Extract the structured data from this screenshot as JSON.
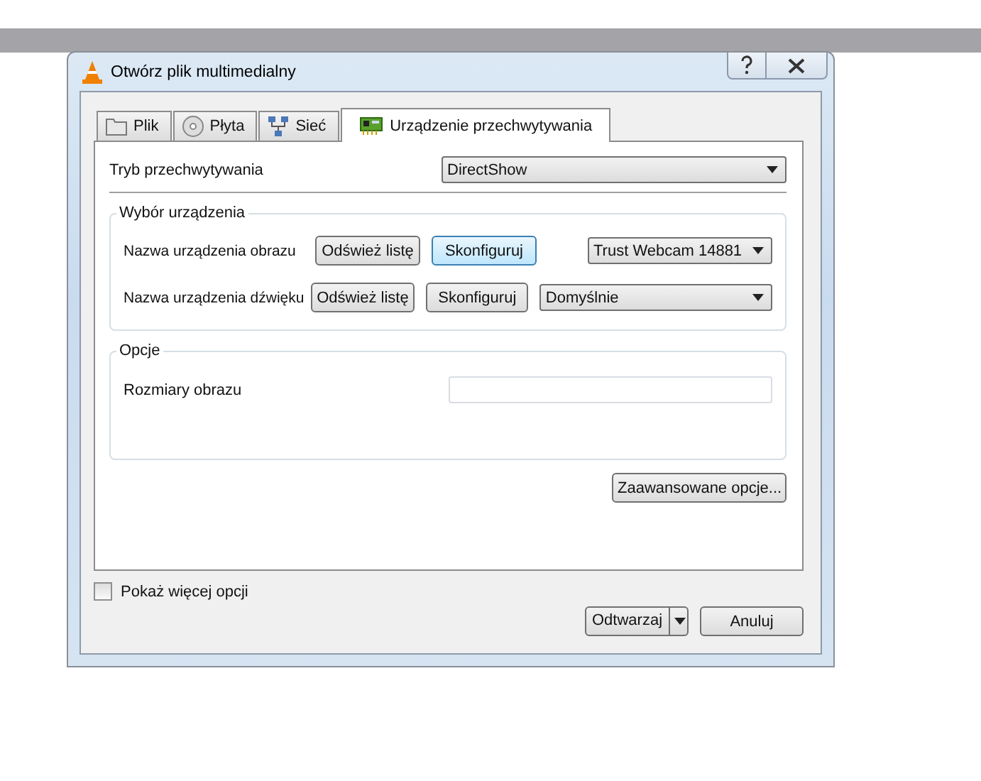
{
  "window": {
    "title": "Otwórz plik multimedialny"
  },
  "tabs": [
    {
      "label": "Plik",
      "kind": "folder",
      "selected": false
    },
    {
      "label": "Płyta",
      "kind": "disc",
      "selected": false
    },
    {
      "label": "Sieć",
      "kind": "network",
      "selected": false
    },
    {
      "label": "Urządzenie przechwytywania",
      "kind": "card",
      "selected": true
    }
  ],
  "capture_mode": {
    "label": "Tryb przechwytywania",
    "value": "DirectShow"
  },
  "device_group": {
    "title": "Wybór urządzenia",
    "rows": [
      {
        "label": "Nazwa urządzenia obrazu",
        "buttons": [
          {
            "label": "Odśwież listę",
            "highlighted": false
          },
          {
            "label": "Skonfiguruj",
            "highlighted": true
          }
        ],
        "dropdown": {
          "kind": "compact",
          "value": "Trust Webcam 14881"
        }
      },
      {
        "label": "Nazwa urządzenia dźwięku",
        "buttons": [
          {
            "label": "Odśwież listę",
            "highlighted": false
          },
          {
            "label": "Skonfiguruj",
            "highlighted": false
          }
        ],
        "dropdown": {
          "kind": "wide",
          "value": "Domyślnie"
        }
      }
    ]
  },
  "options_group": {
    "title": "Opcje",
    "fields": [
      {
        "label": "Rozmiary obrazu"
      }
    ]
  },
  "advanced_button": "Zaawansowane opcje...",
  "show_more": {
    "label": "Pokaż więcej opcji",
    "checked": false
  },
  "footer_buttons": [
    {
      "kind": "split",
      "label": "Odtwarzaj"
    },
    {
      "kind": "plain",
      "label": "Anuluj"
    }
  ]
}
